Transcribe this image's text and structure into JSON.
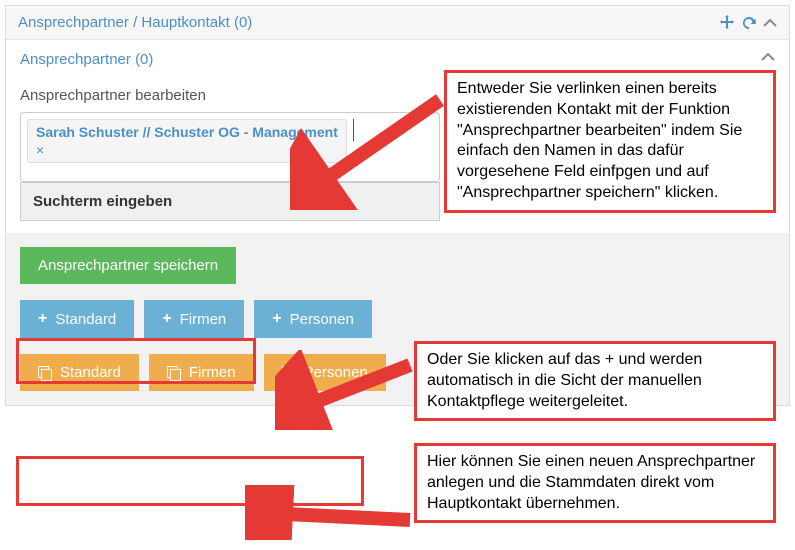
{
  "panel": {
    "title": "Ansprechpartner / Hauptkontakt (0)",
    "subtitle": "Ansprechpartner (0)"
  },
  "edit": {
    "label": "Ansprechpartner bearbeiten",
    "tag": "Sarah Schuster // Schuster OG - Management",
    "tag_remove": "×",
    "search_placeholder": "Suchterm eingeben"
  },
  "buttons": {
    "save": "Ansprechpartner speichern",
    "blue": {
      "standard": "Standard",
      "firmen": "Firmen",
      "personen": "Personen"
    },
    "orange": {
      "standard": "Standard",
      "firmen": "Firmen",
      "personen": "Personen"
    }
  },
  "annotations": {
    "a1": "Entweder Sie verlinken einen bereits existierenden Kontakt mit der Funktion \"Ansprechpartner bearbeiten\" indem Sie einfach den Namen in das dafür vorgesehene Feld einfpgen und auf \"Ansprechpartner speichern\" klicken.",
    "a2": "Oder Sie klicken auf das + und werden automatisch in die Sicht der manuellen Kontaktpflege weitergeleitet.",
    "a3": "Hier können Sie einen neuen Ansprechpartner anlegen und die Stammdaten direkt vom Hauptkontakt übernehmen."
  }
}
